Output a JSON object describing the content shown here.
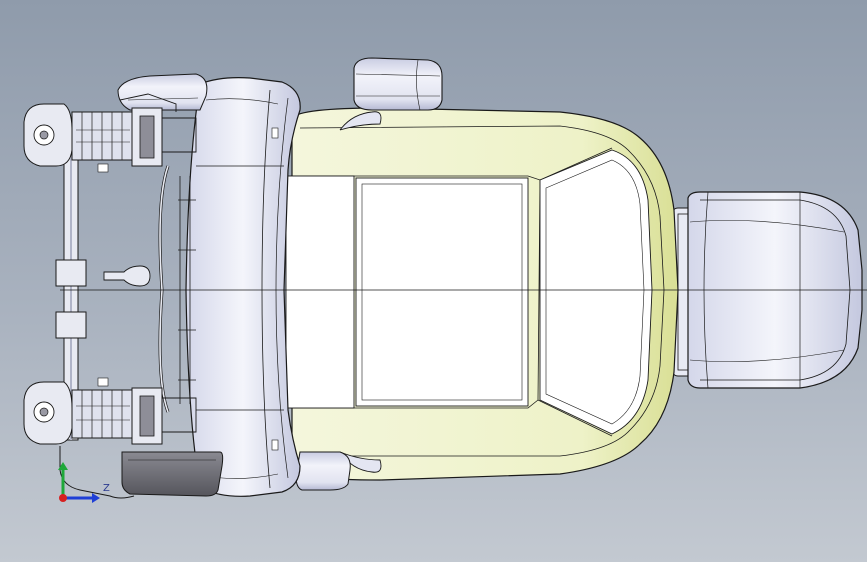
{
  "viewport": {
    "background_top": "#8f9bab",
    "background_bottom": "#c3c9d1"
  },
  "model": {
    "shell_color": "#eef2c8",
    "shell_shade": "#d9df95",
    "plastic_color": "#e4e6f2",
    "plastic_shade": "#b8bcd6",
    "dark_part_color": "#6e6e76",
    "edge_color": "#1a1a1a"
  },
  "triad": {
    "z_label": "Z",
    "x_axis_color": "#1f3fd6",
    "y_axis_color": "#1fa83a",
    "origin_color": "#d62020"
  }
}
